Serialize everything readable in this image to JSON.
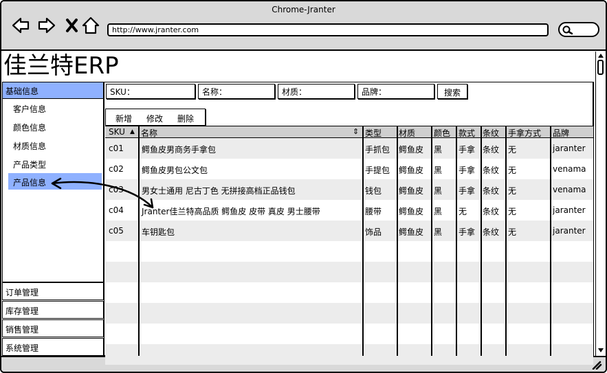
{
  "window": {
    "title": "Chrome-Jranter"
  },
  "browser": {
    "url": "http://www.jranter.com"
  },
  "app": {
    "title": "佳兰特ERP"
  },
  "sidebar": {
    "section_label": "基础信息",
    "items": [
      {
        "label": "客户信息"
      },
      {
        "label": "颜色信息"
      },
      {
        "label": "材质信息"
      },
      {
        "label": "产品类型"
      },
      {
        "label": "产品信息"
      }
    ],
    "bottom_menus": [
      {
        "label": "订单管理"
      },
      {
        "label": "库存管理"
      },
      {
        "label": "销售管理"
      },
      {
        "label": "系统管理"
      }
    ]
  },
  "filters": {
    "sku_label": "SKU：",
    "name_label": "名称：",
    "material_label": "材质：",
    "brand_label": "品牌：",
    "search_label": "搜索"
  },
  "toolbar": {
    "add_label": "新增",
    "edit_label": "修改",
    "delete_label": "删除"
  },
  "table": {
    "columns": [
      "SKU",
      "名称",
      "类型",
      "材质",
      "颜色",
      "款式",
      "条纹",
      "手拿方式",
      "品牌"
    ],
    "sort_indicator": "▲",
    "name_sort_indicator": "⇕",
    "rows": [
      {
        "sku": "c01",
        "name": "鳄鱼皮男商务手拿包",
        "type": "手抓包",
        "material": "鳄鱼皮",
        "color": "黑",
        "style": "手拿",
        "stripe": "条纹",
        "carry": "无",
        "brand": "jaranter"
      },
      {
        "sku": "c02",
        "name": "鳄鱼皮男包公文包",
        "type": "手提包",
        "material": "鳄鱼皮",
        "color": "黑",
        "style": "手拿",
        "stripe": "条纹",
        "carry": "无",
        "brand": "venama"
      },
      {
        "sku": "c03",
        "name": "男女士通用 尼古丁色 无拼接高档正品钱包",
        "type": "钱包",
        "material": "鳄鱼皮",
        "color": "黑",
        "style": "手拿",
        "stripe": "条纹",
        "carry": "无",
        "brand": "venama"
      },
      {
        "sku": "c04",
        "name": "Jranter佳兰特高品质 鳄鱼皮 皮带 真皮 男士腰带",
        "type": "腰带",
        "material": "鳄鱼皮",
        "color": "黑",
        "style": "无",
        "stripe": "条纹",
        "carry": "无",
        "brand": "jaranter"
      },
      {
        "sku": "c05",
        "name": "车钥匙包",
        "type": "饰品",
        "material": "鳄鱼皮",
        "color": "黑",
        "style": "手拿",
        "stripe": "条纹",
        "carry": "无",
        "brand": "jaranter"
      }
    ]
  },
  "colors": {
    "accent": "#8fb1ff",
    "chrome": "#d9d9d9",
    "header": "#cfcfcf",
    "stripe": "#ececec"
  }
}
